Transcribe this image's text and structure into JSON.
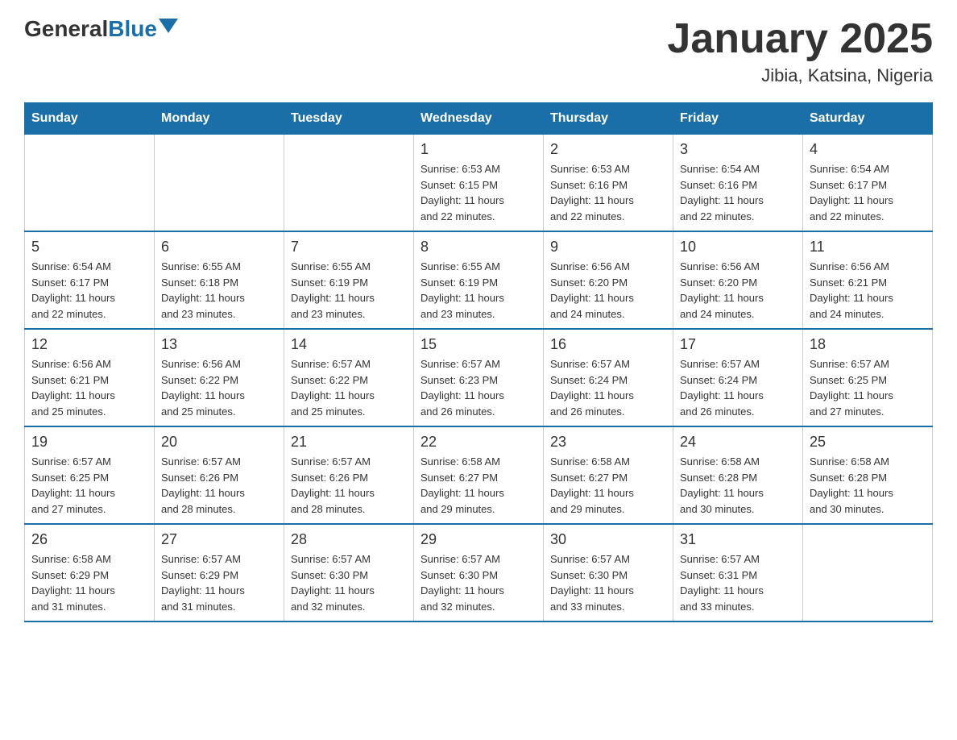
{
  "header": {
    "logo_general": "General",
    "logo_blue": "Blue",
    "title": "January 2025",
    "subtitle": "Jibia, Katsina, Nigeria"
  },
  "days_of_week": [
    "Sunday",
    "Monday",
    "Tuesday",
    "Wednesday",
    "Thursday",
    "Friday",
    "Saturday"
  ],
  "weeks": [
    [
      {
        "day": "",
        "info": ""
      },
      {
        "day": "",
        "info": ""
      },
      {
        "day": "",
        "info": ""
      },
      {
        "day": "1",
        "info": "Sunrise: 6:53 AM\nSunset: 6:15 PM\nDaylight: 11 hours\nand 22 minutes."
      },
      {
        "day": "2",
        "info": "Sunrise: 6:53 AM\nSunset: 6:16 PM\nDaylight: 11 hours\nand 22 minutes."
      },
      {
        "day": "3",
        "info": "Sunrise: 6:54 AM\nSunset: 6:16 PM\nDaylight: 11 hours\nand 22 minutes."
      },
      {
        "day": "4",
        "info": "Sunrise: 6:54 AM\nSunset: 6:17 PM\nDaylight: 11 hours\nand 22 minutes."
      }
    ],
    [
      {
        "day": "5",
        "info": "Sunrise: 6:54 AM\nSunset: 6:17 PM\nDaylight: 11 hours\nand 22 minutes."
      },
      {
        "day": "6",
        "info": "Sunrise: 6:55 AM\nSunset: 6:18 PM\nDaylight: 11 hours\nand 23 minutes."
      },
      {
        "day": "7",
        "info": "Sunrise: 6:55 AM\nSunset: 6:19 PM\nDaylight: 11 hours\nand 23 minutes."
      },
      {
        "day": "8",
        "info": "Sunrise: 6:55 AM\nSunset: 6:19 PM\nDaylight: 11 hours\nand 23 minutes."
      },
      {
        "day": "9",
        "info": "Sunrise: 6:56 AM\nSunset: 6:20 PM\nDaylight: 11 hours\nand 24 minutes."
      },
      {
        "day": "10",
        "info": "Sunrise: 6:56 AM\nSunset: 6:20 PM\nDaylight: 11 hours\nand 24 minutes."
      },
      {
        "day": "11",
        "info": "Sunrise: 6:56 AM\nSunset: 6:21 PM\nDaylight: 11 hours\nand 24 minutes."
      }
    ],
    [
      {
        "day": "12",
        "info": "Sunrise: 6:56 AM\nSunset: 6:21 PM\nDaylight: 11 hours\nand 25 minutes."
      },
      {
        "day": "13",
        "info": "Sunrise: 6:56 AM\nSunset: 6:22 PM\nDaylight: 11 hours\nand 25 minutes."
      },
      {
        "day": "14",
        "info": "Sunrise: 6:57 AM\nSunset: 6:22 PM\nDaylight: 11 hours\nand 25 minutes."
      },
      {
        "day": "15",
        "info": "Sunrise: 6:57 AM\nSunset: 6:23 PM\nDaylight: 11 hours\nand 26 minutes."
      },
      {
        "day": "16",
        "info": "Sunrise: 6:57 AM\nSunset: 6:24 PM\nDaylight: 11 hours\nand 26 minutes."
      },
      {
        "day": "17",
        "info": "Sunrise: 6:57 AM\nSunset: 6:24 PM\nDaylight: 11 hours\nand 26 minutes."
      },
      {
        "day": "18",
        "info": "Sunrise: 6:57 AM\nSunset: 6:25 PM\nDaylight: 11 hours\nand 27 minutes."
      }
    ],
    [
      {
        "day": "19",
        "info": "Sunrise: 6:57 AM\nSunset: 6:25 PM\nDaylight: 11 hours\nand 27 minutes."
      },
      {
        "day": "20",
        "info": "Sunrise: 6:57 AM\nSunset: 6:26 PM\nDaylight: 11 hours\nand 28 minutes."
      },
      {
        "day": "21",
        "info": "Sunrise: 6:57 AM\nSunset: 6:26 PM\nDaylight: 11 hours\nand 28 minutes."
      },
      {
        "day": "22",
        "info": "Sunrise: 6:58 AM\nSunset: 6:27 PM\nDaylight: 11 hours\nand 29 minutes."
      },
      {
        "day": "23",
        "info": "Sunrise: 6:58 AM\nSunset: 6:27 PM\nDaylight: 11 hours\nand 29 minutes."
      },
      {
        "day": "24",
        "info": "Sunrise: 6:58 AM\nSunset: 6:28 PM\nDaylight: 11 hours\nand 30 minutes."
      },
      {
        "day": "25",
        "info": "Sunrise: 6:58 AM\nSunset: 6:28 PM\nDaylight: 11 hours\nand 30 minutes."
      }
    ],
    [
      {
        "day": "26",
        "info": "Sunrise: 6:58 AM\nSunset: 6:29 PM\nDaylight: 11 hours\nand 31 minutes."
      },
      {
        "day": "27",
        "info": "Sunrise: 6:57 AM\nSunset: 6:29 PM\nDaylight: 11 hours\nand 31 minutes."
      },
      {
        "day": "28",
        "info": "Sunrise: 6:57 AM\nSunset: 6:30 PM\nDaylight: 11 hours\nand 32 minutes."
      },
      {
        "day": "29",
        "info": "Sunrise: 6:57 AM\nSunset: 6:30 PM\nDaylight: 11 hours\nand 32 minutes."
      },
      {
        "day": "30",
        "info": "Sunrise: 6:57 AM\nSunset: 6:30 PM\nDaylight: 11 hours\nand 33 minutes."
      },
      {
        "day": "31",
        "info": "Sunrise: 6:57 AM\nSunset: 6:31 PM\nDaylight: 11 hours\nand 33 minutes."
      },
      {
        "day": "",
        "info": ""
      }
    ]
  ]
}
